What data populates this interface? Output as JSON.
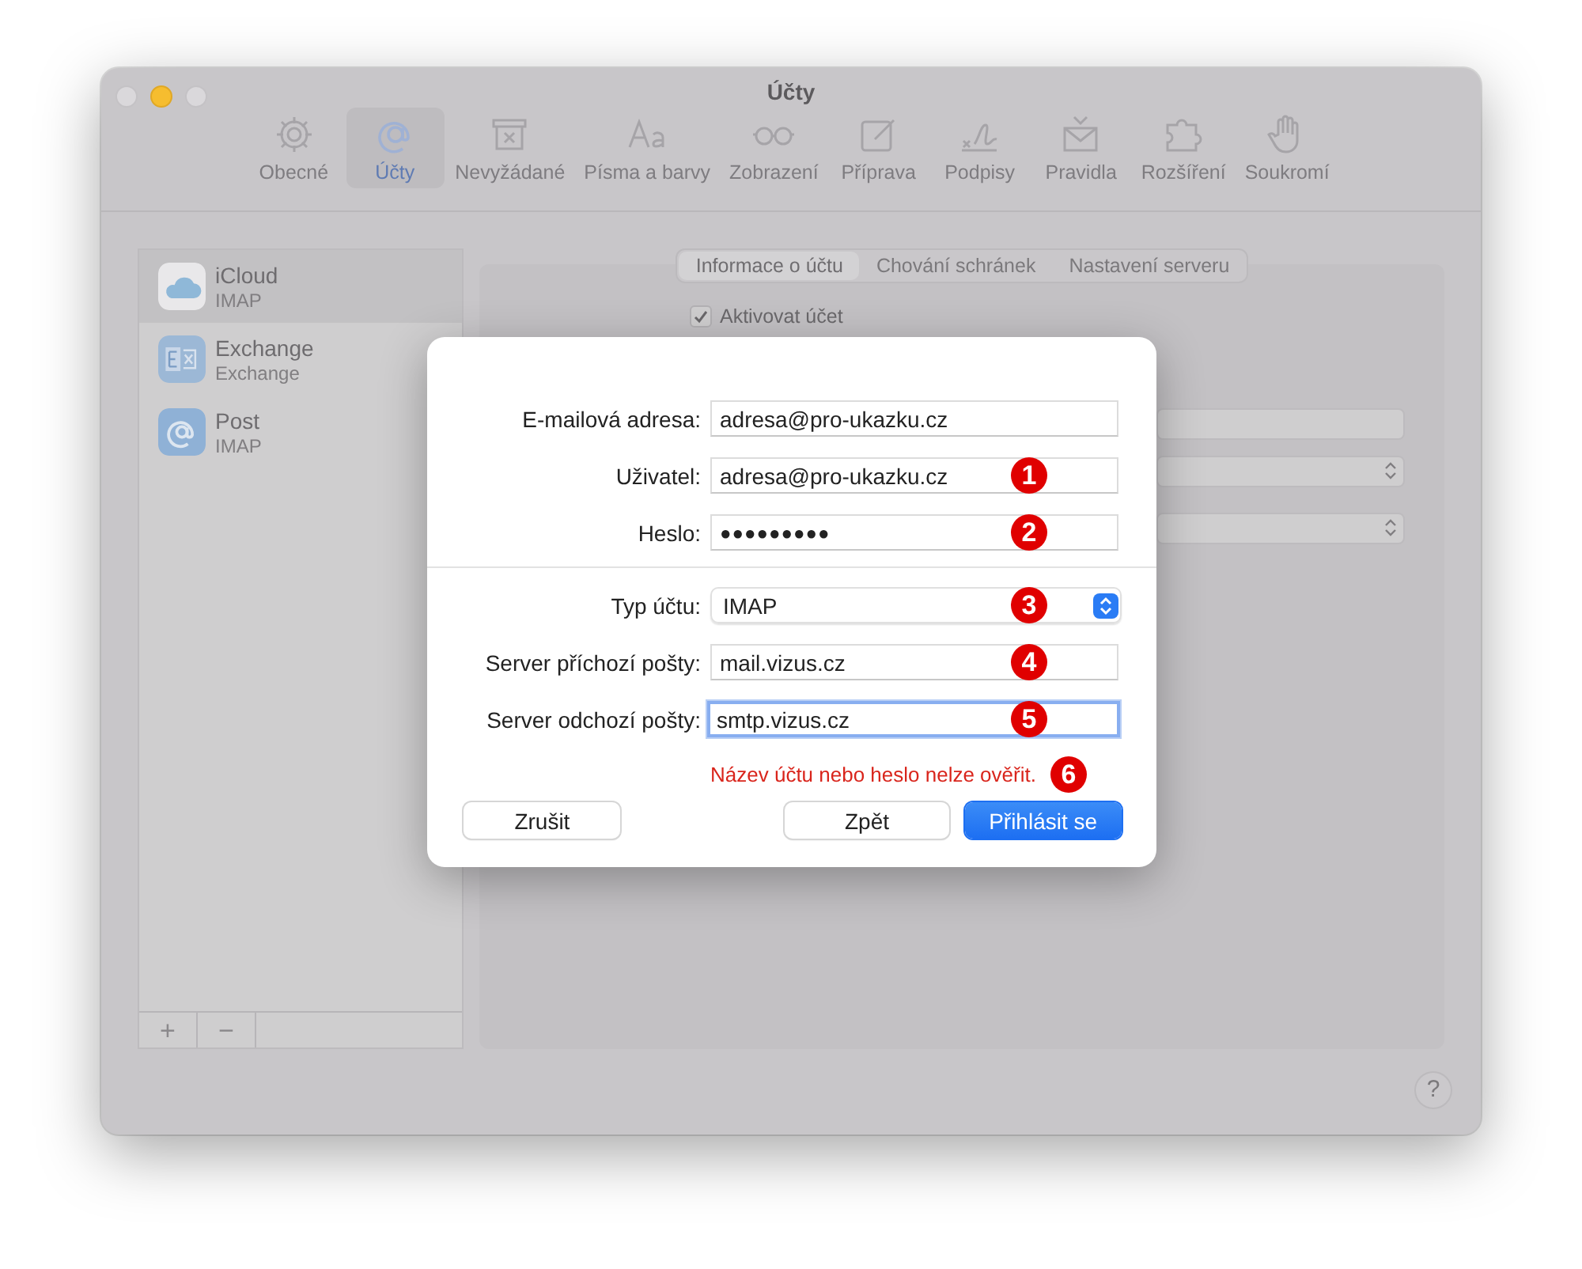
{
  "window": {
    "title": "Účty"
  },
  "toolbar": [
    {
      "label": "Obecné",
      "selected": false
    },
    {
      "label": "Účty",
      "selected": true
    },
    {
      "label": "Nevyžádané",
      "selected": false
    },
    {
      "label": "Písma a barvy",
      "selected": false
    },
    {
      "label": "Zobrazení",
      "selected": false
    },
    {
      "label": "Příprava",
      "selected": false
    },
    {
      "label": "Podpisy",
      "selected": false
    },
    {
      "label": "Pravidla",
      "selected": false
    },
    {
      "label": "Rozšíření",
      "selected": false
    },
    {
      "label": "Soukromí",
      "selected": false
    }
  ],
  "accounts": [
    {
      "name": "iCloud",
      "type": "IMAP",
      "selected": true
    },
    {
      "name": "Exchange",
      "type": "Exchange",
      "selected": false
    },
    {
      "name": "Post",
      "type": "IMAP",
      "selected": false
    }
  ],
  "list_buttons": [
    "+",
    "−"
  ],
  "tabs": [
    {
      "label": "Informace o účtu",
      "selected": true
    },
    {
      "label": "Chování schránek",
      "selected": false
    },
    {
      "label": "Nastavení serveru",
      "selected": false
    }
  ],
  "activate_checkbox": {
    "label": "Aktivovat účet",
    "checked": true
  },
  "dialog": {
    "rows": [
      {
        "label": "E-mailová adresa:",
        "kind": "text",
        "value": "adresa@pro-ukazku.cz",
        "focused": false
      },
      {
        "label": "Uživatel:",
        "kind": "text",
        "value": "adresa@pro-ukazku.cz",
        "focused": false,
        "badge": "1"
      },
      {
        "label": "Heslo:",
        "kind": "password",
        "value": "●●●●●●●●●",
        "focused": false,
        "badge": "2"
      },
      {
        "kind": "divider"
      },
      {
        "label": "Typ účtu:",
        "kind": "popup",
        "value": "IMAP",
        "focused": false,
        "badge": "3"
      },
      {
        "label": "Server příchozí pošty:",
        "kind": "text",
        "value": "mail.vizus.cz",
        "focused": false,
        "badge": "4"
      },
      {
        "label": "Server odchozí pošty:",
        "kind": "text",
        "value": "smtp.vizus.cz",
        "focused": true,
        "badge": "5"
      }
    ],
    "error": {
      "text": "Název účtu nebo heslo nelze ověřit.",
      "badge": "6"
    },
    "buttons": [
      {
        "label": "Zrušit",
        "kind": "cancel"
      },
      {
        "label": "Zpět",
        "kind": "normal"
      },
      {
        "label": "Přihlásit se",
        "kind": "default"
      }
    ]
  },
  "help_button": "?"
}
